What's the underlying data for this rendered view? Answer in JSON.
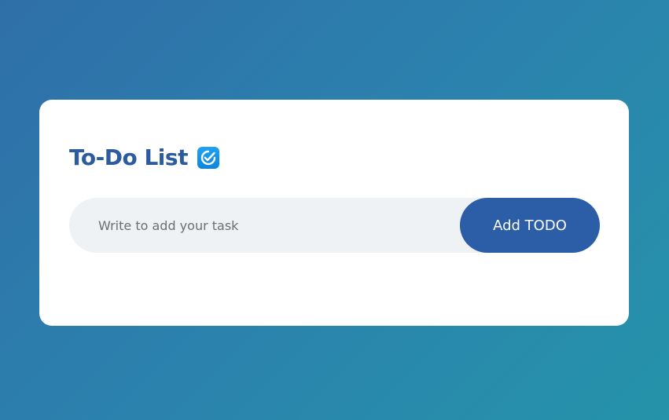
{
  "card": {
    "title": "To-Do List",
    "title_icon": "check-badge-icon"
  },
  "task_input": {
    "value": "",
    "placeholder": "Write to add your task"
  },
  "add_button": {
    "label": "Add TODO"
  },
  "colors": {
    "background_start": "#2f6fa9",
    "background_end": "#2593aa",
    "title": "#2c5b9e",
    "button": "#2c5ea8",
    "input_background": "#eef2f4",
    "icon": "#0d85e0"
  }
}
